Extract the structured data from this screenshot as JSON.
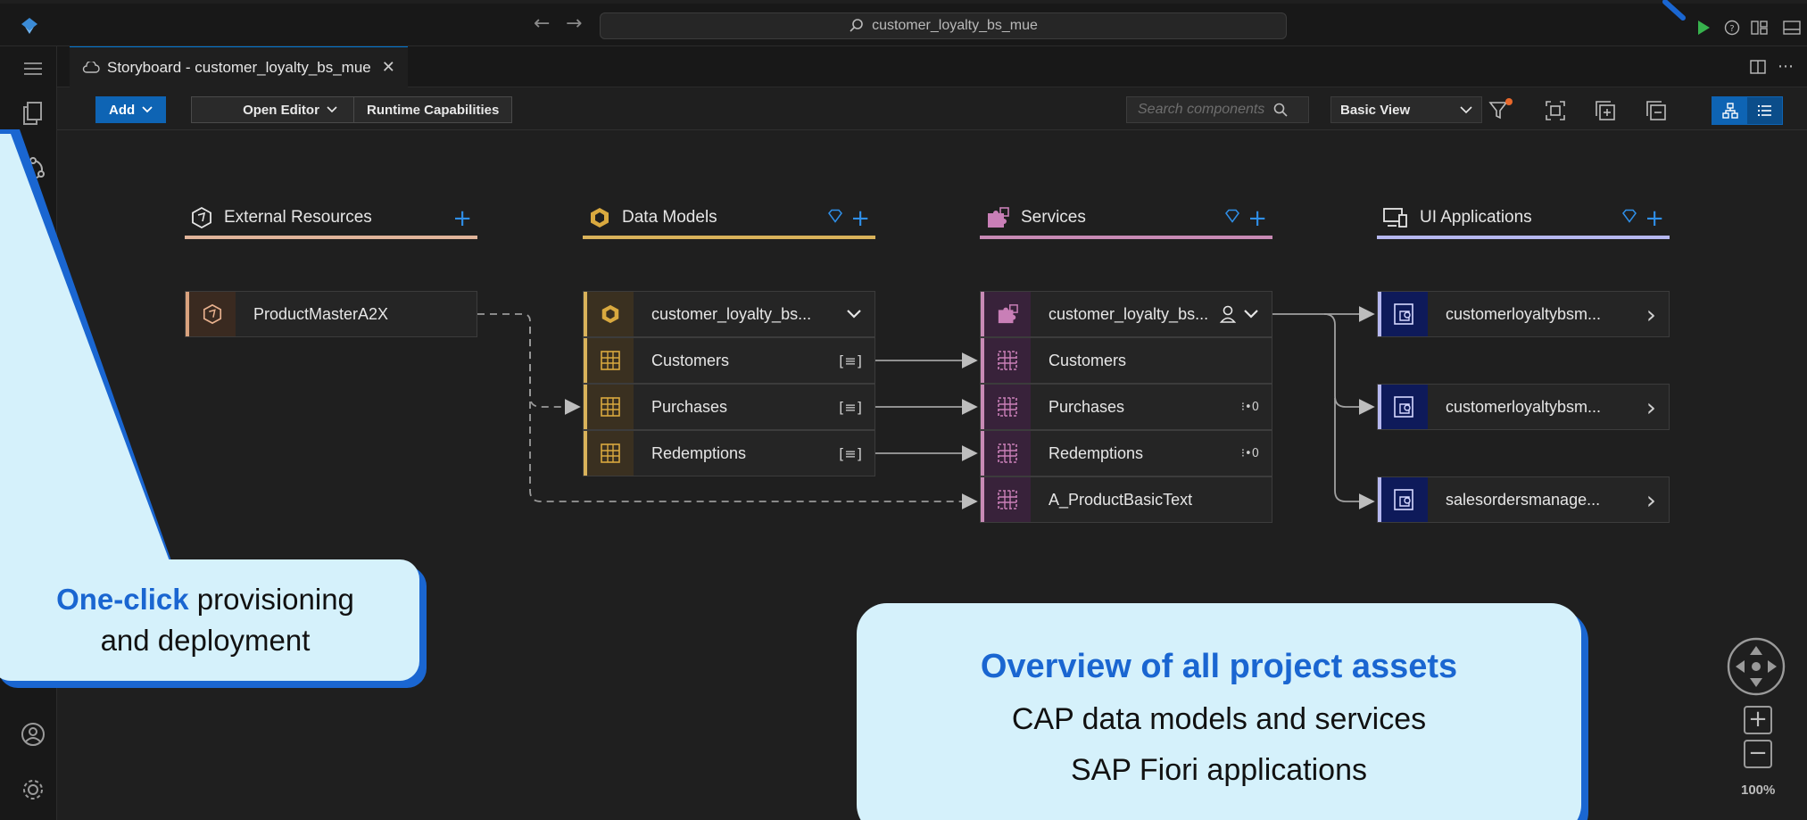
{
  "titlebar": {
    "search_text": "customer_loyalty_bs_mue",
    "back_arrow": "←",
    "forward_arrow": "→"
  },
  "tab": {
    "label": "Storyboard - customer_loyalty_bs_mue",
    "close": "✕"
  },
  "toolbar": {
    "add_label": "Add",
    "open_editor_label": "Open Editor",
    "runtime_label": "Runtime Capabilities",
    "search_placeholder": "Search components",
    "view_label": "Basic View"
  },
  "columns": [
    {
      "title": "External Resources",
      "color": "#e0b49a"
    },
    {
      "title": "Data Models",
      "color": "#d9b25a"
    },
    {
      "title": "Services",
      "color": "#c88ab5"
    },
    {
      "title": "UI Applications",
      "color": "#b6b8f0"
    }
  ],
  "external_resources": [
    {
      "label": "ProductMasterA2X"
    }
  ],
  "data_models": [
    {
      "label": "customer_loyalty_bs...",
      "end": "⌄"
    },
    {
      "label": "Customers",
      "end": "[≡]"
    },
    {
      "label": "Purchases",
      "end": "[≡]"
    },
    {
      "label": "Redemptions",
      "end": "[≡]"
    }
  ],
  "services": [
    {
      "label": "customer_loyalty_bs...",
      "end": "⌄"
    },
    {
      "label": "Customers",
      "end": ""
    },
    {
      "label": "Purchases",
      "end": "⁝•0"
    },
    {
      "label": "Redemptions",
      "end": "⁝•0"
    },
    {
      "label": "A_ProductBasicText",
      "end": ""
    }
  ],
  "ui_applications": [
    {
      "label": "customerloyaltybsm...",
      "end": "›"
    },
    {
      "label": "customerloyaltybsm...",
      "end": "›"
    },
    {
      "label": "salesordersmanage...",
      "end": "›"
    }
  ],
  "callout_left": {
    "highlight": "One-click",
    "line1_rest": " provisioning",
    "line2": "and deployment"
  },
  "callout_right": {
    "title": "Overview of all project assets",
    "line1": "CAP data models and services",
    "line2": "SAP Fiori applications"
  },
  "zoom": {
    "level": "100%",
    "plus": "+",
    "minus": "−"
  },
  "colors": {
    "accent": "#0e64b4",
    "callout_bg": "#d5f1fb",
    "callout_accent": "#1a66d1",
    "run_green": "#37b24d"
  }
}
